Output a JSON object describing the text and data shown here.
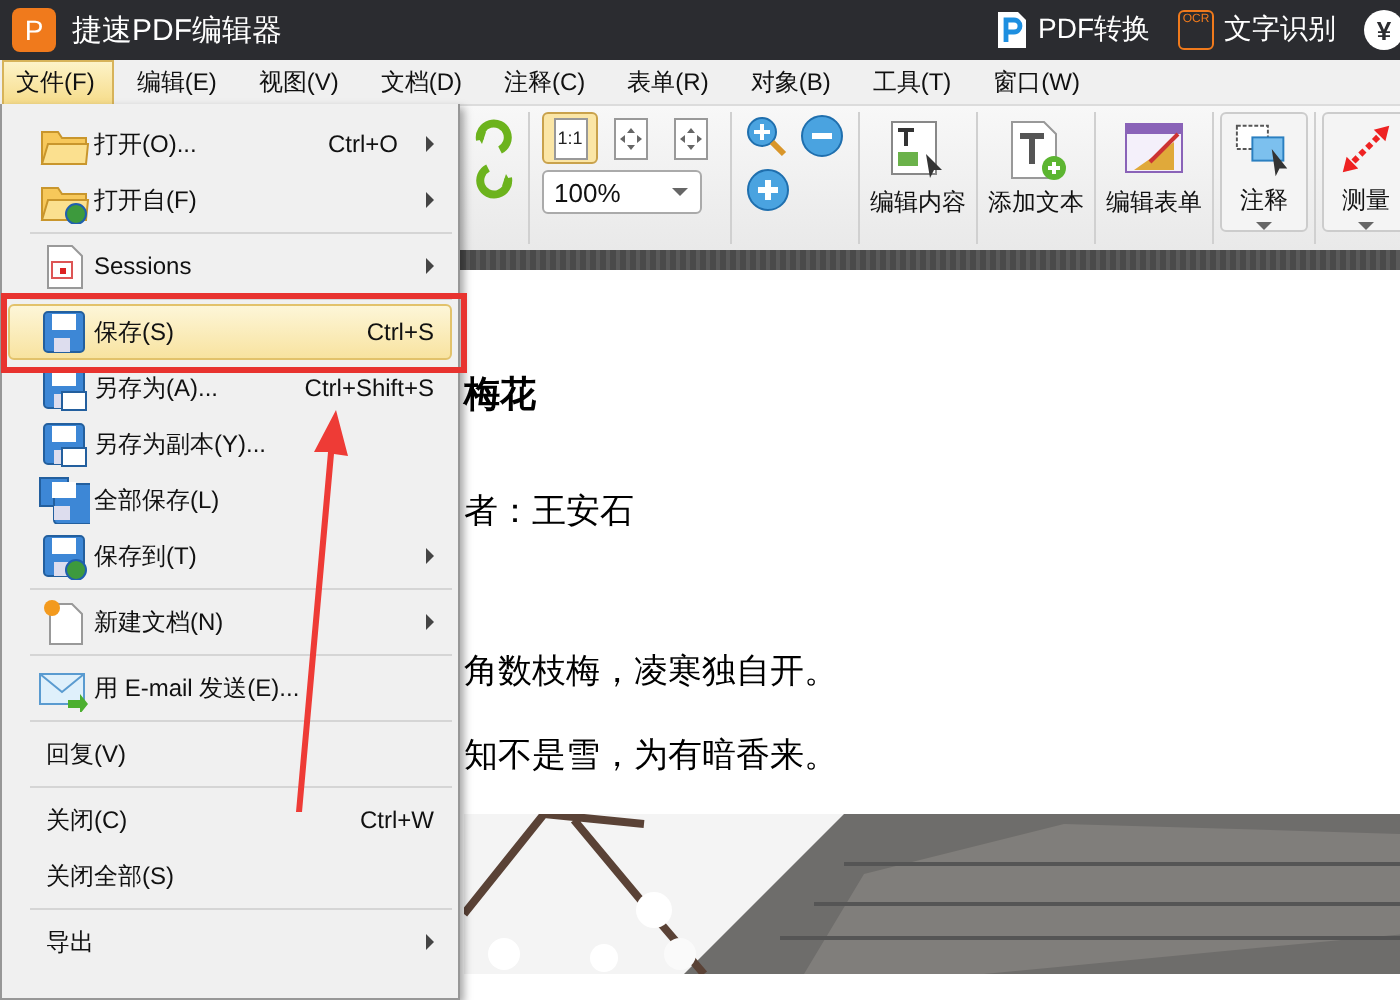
{
  "window": {
    "logo": "P",
    "title": "捷速PDF编辑器"
  },
  "title_actions": [
    {
      "label": "PDF转换"
    },
    {
      "label": "文字识别",
      "badge": "OCR"
    }
  ],
  "coin": "¥",
  "menubar": [
    {
      "label": "文件(F)",
      "selected": true
    },
    {
      "label": "编辑(E)",
      "selected": false
    },
    {
      "label": "视图(V)",
      "selected": false
    },
    {
      "label": "文档(D)",
      "selected": false
    },
    {
      "label": "注释(C)",
      "selected": false
    },
    {
      "label": "表单(R)",
      "selected": false
    },
    {
      "label": "对象(B)",
      "selected": false
    },
    {
      "label": "工具(T)",
      "selected": false
    },
    {
      "label": "窗口(W)",
      "selected": false
    }
  ],
  "toolbar": {
    "view_buttons": [
      {
        "label": "1:1",
        "selected": true
      },
      {
        "selected": false
      },
      {
        "selected": false
      }
    ],
    "zoom_field": {
      "value": "100%"
    },
    "buttons": [
      {
        "label": "编辑内容",
        "dropdown": false
      },
      {
        "label": "添加文本",
        "dropdown": false
      },
      {
        "label": "编辑表单",
        "dropdown": false
      },
      {
        "label": "注释",
        "dropdown": true
      },
      {
        "label": "测量",
        "dropdown": true
      }
    ]
  },
  "file_menu": {
    "groups": [
      {
        "items": [
          {
            "label": "打开(O)...",
            "shortcut": "Ctrl+O",
            "submenu": true,
            "selected": false
          },
          {
            "label": "打开自(F)",
            "submenu": true,
            "selected": false
          }
        ]
      },
      {
        "items": [
          {
            "label": "Sessions",
            "submenu": true,
            "selected": false
          }
        ]
      },
      {
        "items": [
          {
            "label": "保存(S)",
            "shortcut": "Ctrl+S",
            "submenu": false,
            "selected": true
          },
          {
            "label": "另存为(A)...",
            "shortcut": "Ctrl+Shift+S",
            "submenu": false,
            "selected": false
          },
          {
            "label": "另存为副本(Y)...",
            "submenu": false,
            "selected": false
          },
          {
            "label": "全部保存(L)",
            "submenu": false,
            "selected": false
          },
          {
            "label": "保存到(T)",
            "submenu": true,
            "selected": false
          }
        ]
      },
      {
        "items": [
          {
            "label": "新建文档(N)",
            "submenu": true,
            "selected": false
          }
        ]
      },
      {
        "items": [
          {
            "label": "用 E-mail 发送(E)...",
            "submenu": false,
            "selected": false
          }
        ]
      },
      {
        "items": [
          {
            "label": "回复(V)",
            "submenu": false,
            "selected": false
          }
        ]
      },
      {
        "items": [
          {
            "label": "关闭(C)",
            "shortcut": "Ctrl+W",
            "submenu": false,
            "selected": false
          },
          {
            "label": "关闭全部(S)",
            "submenu": false,
            "selected": false
          }
        ]
      },
      {
        "items": [
          {
            "label": "导出",
            "submenu": true,
            "selected": false
          }
        ]
      }
    ]
  },
  "document": {
    "title": "梅花",
    "author": "者：王安石",
    "lines": [
      "角数枝梅，凌寒独自开。",
      "知不是雪，为有暗香来。"
    ],
    "image": {
      "kind": "picture"
    }
  }
}
